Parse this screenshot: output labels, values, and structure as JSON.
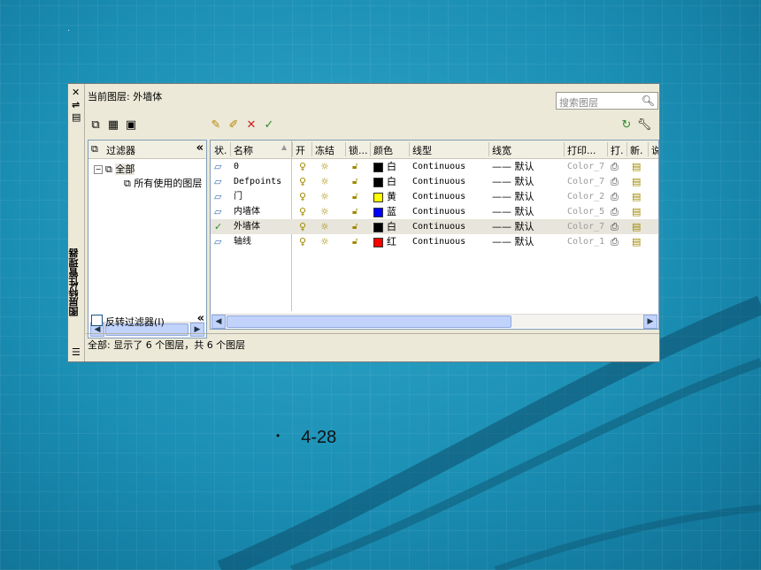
{
  "window": {
    "current_layer_label": "当前图层: 外墙体",
    "search_placeholder": "搜索图层",
    "vertical_title": "图层特性管理器",
    "status_text": "全部: 显示了 6 个图层，共 6 个图层"
  },
  "filter_pane": {
    "header": "过滤器",
    "tree": [
      {
        "label": "全部"
      },
      {
        "label": "所有使用的图层"
      }
    ],
    "invert_label": "反转过滤器(I)"
  },
  "columns": [
    "状.",
    "名称",
    "开",
    "冻结",
    "锁...",
    "颜色",
    "线型",
    "线宽",
    "打印...",
    "打.",
    "新.",
    "说"
  ],
  "layers": [
    {
      "name": "0",
      "color_name": "白",
      "color_hex": "#000000",
      "linetype": "Continuous",
      "lineweight": "—— 默认",
      "plot_style": "Color_7",
      "current": false
    },
    {
      "name": "Defpoints",
      "color_name": "白",
      "color_hex": "#000000",
      "linetype": "Continuous",
      "lineweight": "—— 默认",
      "plot_style": "Color_7",
      "current": false
    },
    {
      "name": "门",
      "color_name": "黄",
      "color_hex": "#ffff00",
      "linetype": "Continuous",
      "lineweight": "—— 默认",
      "plot_style": "Color_2",
      "current": false
    },
    {
      "name": "内墙体",
      "color_name": "蓝",
      "color_hex": "#0000ff",
      "linetype": "Continuous",
      "lineweight": "—— 默认",
      "plot_style": "Color_5",
      "current": false
    },
    {
      "name": "外墙体",
      "color_name": "白",
      "color_hex": "#000000",
      "linetype": "Continuous",
      "lineweight": "—— 默认",
      "plot_style": "Color_7",
      "current": true
    },
    {
      "name": "轴线",
      "color_name": "红",
      "color_hex": "#ff0000",
      "linetype": "Continuous",
      "lineweight": "—— 默认",
      "plot_style": "Color_1",
      "current": false
    }
  ],
  "caption": "4-28",
  "colors": {
    "background": "#1a8fb3",
    "current_check": "#2e8b2e"
  },
  "icons": [
    "close-icon",
    "auto-hide-icon",
    "properties-icon",
    "new-filter-icon",
    "group-filter-icon",
    "filter-states-icon",
    "new-layer-icon",
    "new-vp-layer-icon",
    "delete-layer-icon",
    "set-current-icon",
    "refresh-icon",
    "settings-icon",
    "search-icon"
  ]
}
